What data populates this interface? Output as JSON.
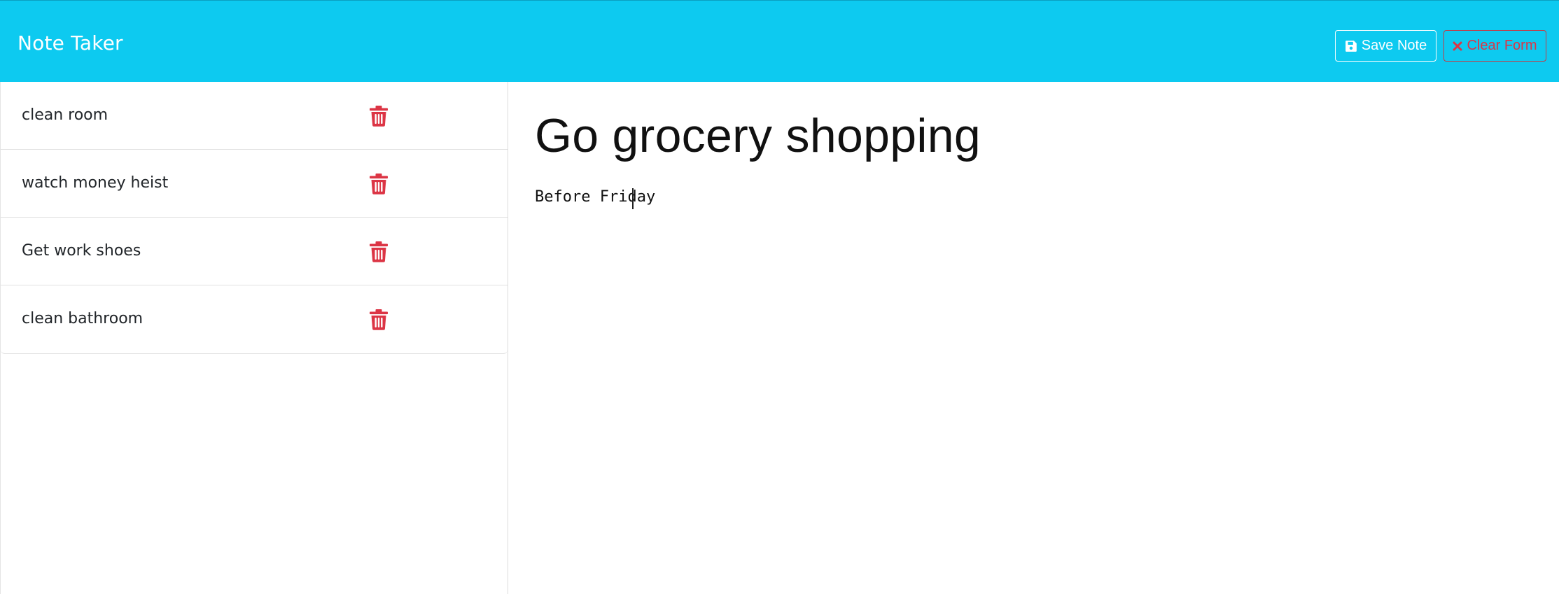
{
  "app": {
    "title": "Note Taker"
  },
  "toolbar": {
    "save_label": "Save Note",
    "save_icon": "save-icon",
    "clear_label": "Clear Form",
    "clear_icon": "close-icon",
    "clear_color": "#dc3545"
  },
  "sidebar": {
    "delete_icon": "trash-icon",
    "delete_color": "#dc3545",
    "notes": [
      {
        "title": "clean room"
      },
      {
        "title": "watch money heist"
      },
      {
        "title": "Get work shoes"
      },
      {
        "title": "clean bathroom"
      }
    ]
  },
  "editor": {
    "title_value": "Go grocery shopping",
    "body_value": "Before Friday"
  },
  "colors": {
    "navbar": "#0dcaf0",
    "danger": "#dc3545"
  }
}
